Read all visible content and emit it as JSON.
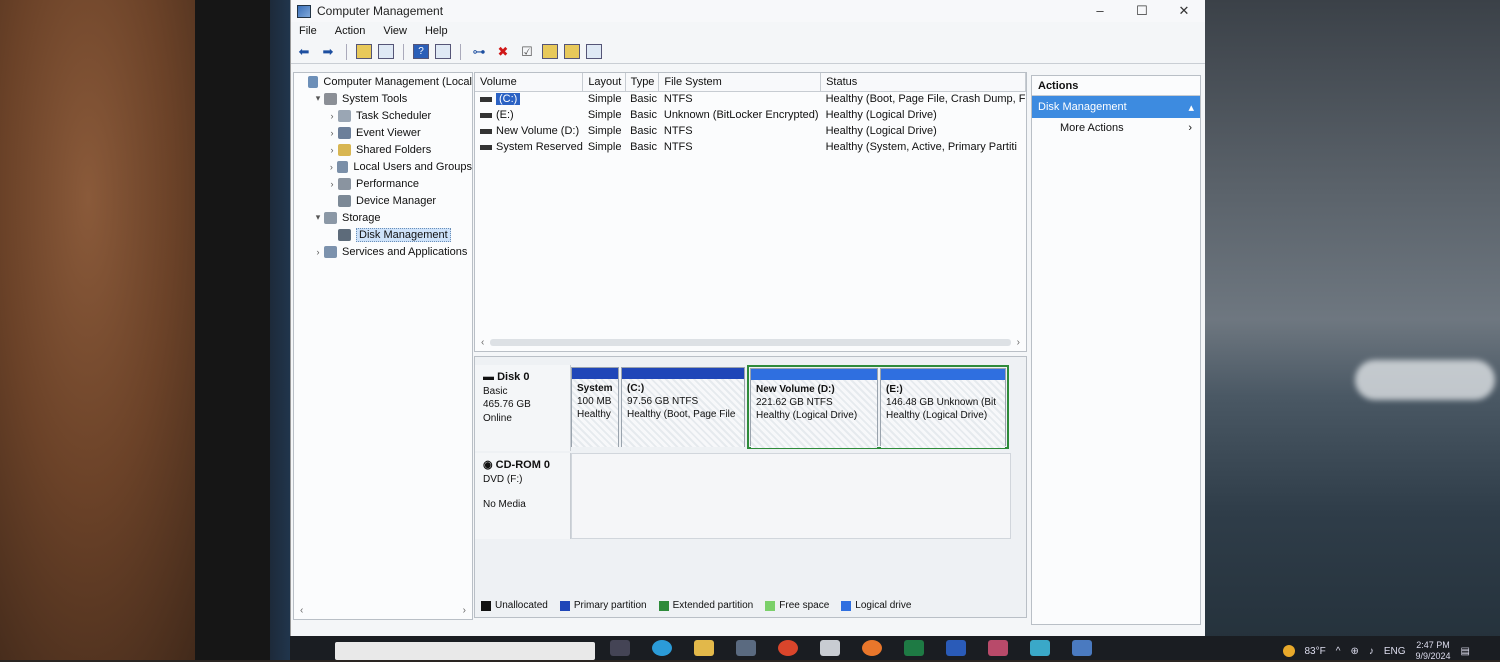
{
  "window": {
    "title": "Computer Management"
  },
  "menu": [
    "File",
    "Action",
    "View",
    "Help"
  ],
  "toolbar": {
    "icons": [
      "back-arrow-icon",
      "forward-arrow-icon",
      "up-folder-icon",
      "show-hide-tree-icon",
      "help-icon",
      "properties-icon",
      "connect-icon",
      "delete-icon",
      "check-icon",
      "open-icon",
      "search-icon",
      "view-icon"
    ]
  },
  "tree": {
    "items": [
      {
        "label": "Computer Management (Local",
        "indent": 0,
        "twisty": "",
        "icon": "#6c8fb8"
      },
      {
        "label": "System Tools",
        "indent": 1,
        "twisty": "▾",
        "icon": "#8b8f96"
      },
      {
        "label": "Task Scheduler",
        "indent": 2,
        "twisty": "›",
        "icon": "#9aa6b4"
      },
      {
        "label": "Event Viewer",
        "indent": 2,
        "twisty": "›",
        "icon": "#6c7f9a"
      },
      {
        "label": "Shared Folders",
        "indent": 2,
        "twisty": "›",
        "icon": "#d8b652"
      },
      {
        "label": "Local Users and Groups",
        "indent": 2,
        "twisty": "›",
        "icon": "#7a8fa8"
      },
      {
        "label": "Performance",
        "indent": 2,
        "twisty": "›",
        "icon": "#8a94a0"
      },
      {
        "label": "Device Manager",
        "indent": 2,
        "twisty": "",
        "icon": "#7c8996"
      },
      {
        "label": "Storage",
        "indent": 1,
        "twisty": "▾",
        "icon": "#8b98a6"
      },
      {
        "label": "Disk Management",
        "indent": 2,
        "twisty": "",
        "icon": "#5d6b7a",
        "selected": true
      },
      {
        "label": "Services and Applications",
        "indent": 1,
        "twisty": "›",
        "icon": "#7c92ad"
      }
    ]
  },
  "volumes": {
    "columns": [
      "Volume",
      "Layout",
      "Type",
      "File System",
      "Status"
    ],
    "rows": [
      {
        "volume": "(C:)",
        "layout": "Simple",
        "type": "Basic",
        "fs": "NTFS",
        "status": "Healthy (Boot, Page File, Crash Dump, F",
        "selected": true
      },
      {
        "volume": "(E:)",
        "layout": "Simple",
        "type": "Basic",
        "fs": "Unknown (BitLocker Encrypted)",
        "status": "Healthy (Logical Drive)"
      },
      {
        "volume": "New Volume (D:)",
        "layout": "Simple",
        "type": "Basic",
        "fs": "NTFS",
        "status": "Healthy (Logical Drive)"
      },
      {
        "volume": "System Reserved",
        "layout": "Simple",
        "type": "Basic",
        "fs": "NTFS",
        "status": "Healthy (System, Active, Primary Partiti"
      }
    ]
  },
  "disk0": {
    "name": "Disk 0",
    "type": "Basic",
    "size": "465.76 GB",
    "state": "Online",
    "partitions": [
      {
        "name": "System",
        "size": "100 MB",
        "status": "Healthy"
      },
      {
        "name": "(C:)",
        "size": "97.56 GB NTFS",
        "status": "Healthy (Boot, Page File"
      },
      {
        "name": "New Volume (D:)",
        "size": "221.62 GB NTFS",
        "status": "Healthy (Logical Drive)"
      },
      {
        "name": "(E:)",
        "size": "146.48 GB Unknown (Bit",
        "status": "Healthy (Logical Drive)"
      }
    ]
  },
  "cdrom0": {
    "name": "CD-ROM 0",
    "type": "DVD (F:)",
    "media": "No Media"
  },
  "legend": [
    {
      "label": "Unallocated",
      "color": "#111111"
    },
    {
      "label": "Primary partition",
      "color": "#1f46b8"
    },
    {
      "label": "Extended partition",
      "color": "#2e8b3a"
    },
    {
      "label": "Free space",
      "color": "#7bd06a"
    },
    {
      "label": "Logical drive",
      "color": "#2f6fe0"
    }
  ],
  "actions": {
    "header": "Actions",
    "group": "Disk Management",
    "items": [
      "More Actions"
    ]
  },
  "taskbar": {
    "temp": "83°F",
    "lang": "ENG",
    "time": "2:47 PM",
    "date": "9/9/2024"
  }
}
